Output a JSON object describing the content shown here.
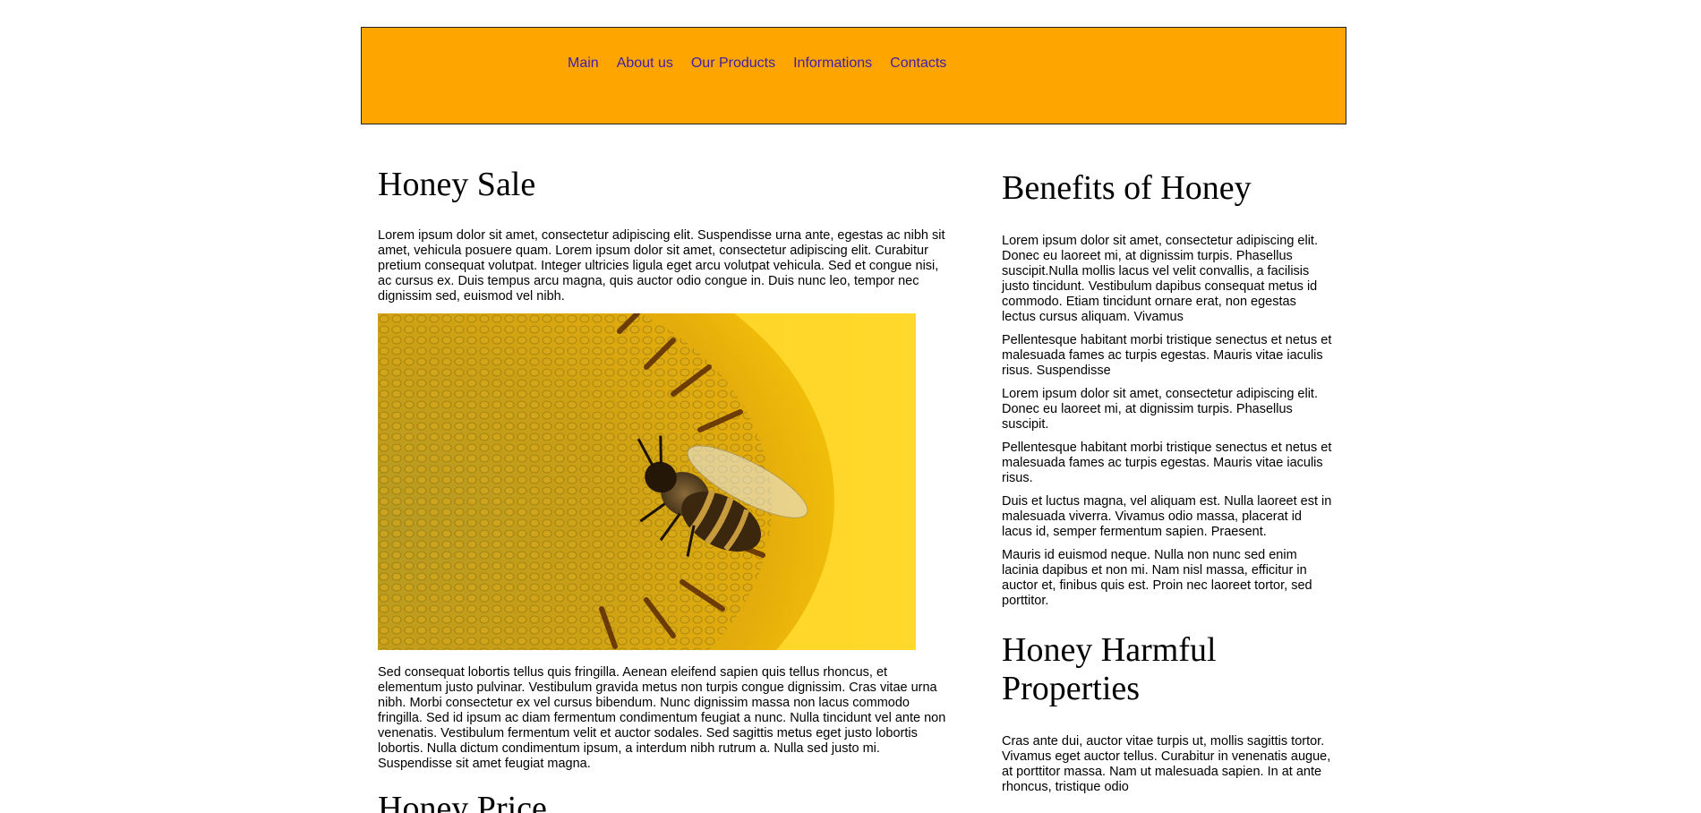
{
  "colors": {
    "header_bg": "#FFA500",
    "nav_link": "#3f1fa8"
  },
  "nav": [
    {
      "label": "Main"
    },
    {
      "label": "About us"
    },
    {
      "label": "Our Products"
    },
    {
      "label": "Informations"
    },
    {
      "label": "Contacts"
    }
  ],
  "main": {
    "sale_title": "Honey Sale",
    "intro_text": "Lorem ipsum dolor sit amet, consectetur adipiscing elit. Suspendisse urna ante, egestas ac nibh sit amet, vehicula posuere quam. Lorem ipsum dolor sit amet, consectetur adipiscing elit. Curabitur pretium consequat volutpat. Integer ultricies ligula eget arcu volutpat vehicula. Sed et congue nisi, ac cursus ex. Duis tempus arcu magna, quis auctor odio congue in. Duis nunc leo, tempor nec dignissim sed, euismod vel nibh.",
    "image_icon": "bee-on-sunflower-image",
    "after_text": "Sed consequat lobortis tellus quis fringilla. Aenean eleifend sapien quis tellus rhoncus, et elementum justo pulvinar. Vestibulum gravida metus non turpis congue dignissim. Cras vitae urna nibh. Morbi consectetur ex vel cursus bibendum. Nunc dignissim massa non lacus commodo fringilla. Sed id ipsum ac diam fermentum condimentum feugiat a nunc. Nulla tincidunt vel ante non venenatis. Vestibulum fermentum velit et auctor sodales. Sed sagittis metus eget justo lobortis lobortis. Nulla dictum condimentum ipsum, a interdum nibh rutrum a. Nulla sed justo mi. Suspendisse sit amet feugiat magna.",
    "price_title": "Honey Price"
  },
  "side": {
    "benefits_title": "Benefits of Honey",
    "paragraphs": [
      "Lorem ipsum dolor sit amet, consectetur adipiscing elit. Donec eu laoreet mi, at dignissim turpis. Phasellus suscipit.Nulla mollis lacus vel velit convallis, a facilisis justo tincidunt. Vestibulum dapibus consequat metus id commodo. Etiam tincidunt ornare erat, non egestas lectus cursus aliquam. Vivamus",
      "Pellentesque habitant morbi tristique senectus et netus et malesuada fames ac turpis egestas. Mauris vitae iaculis risus. Suspendisse",
      "Lorem ipsum dolor sit amet, consectetur adipiscing elit. Donec eu laoreet mi, at dignissim turpis. Phasellus suscipit.",
      "Pellentesque habitant morbi tristique senectus et netus et malesuada fames ac turpis egestas. Mauris vitae iaculis risus.",
      "Duis et luctus magna, vel aliquam est. Nulla laoreet est in malesuada viverra. Vivamus odio massa, placerat id lacus id, semper fermentum sapien. Praesent.",
      "Mauris id euismod neque. Nulla non nunc sed enim lacinia dapibus et non mi. Nam nisl massa, efficitur in auctor et, finibus quis est. Proin nec laoreet tortor, sed porttitor."
    ],
    "harmful_title": "Honey Harmful Properties",
    "harmful_text": "Cras ante dui, auctor vitae turpis ut, mollis sagittis tortor. Vivamus eget auctor tellus. Curabitur in venenatis augue, at porttitor massa. Nam ut malesuada sapien. In at ante rhoncus, tristique odio"
  }
}
